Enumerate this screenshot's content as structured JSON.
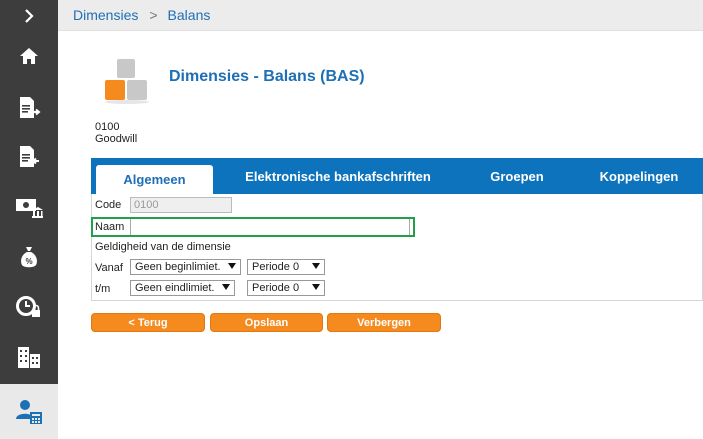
{
  "breadcrumb": [
    "Dimensies",
    "Balans"
  ],
  "header": {
    "title": "Dimensies - Balans (BAS)",
    "account_code": "0100",
    "account_name": "Goodwill"
  },
  "sidebar": {
    "items": [
      {
        "icon": "home-icon"
      },
      {
        "icon": "document-out-icon"
      },
      {
        "icon": "document-in-icon"
      },
      {
        "icon": "bank-icon"
      },
      {
        "icon": "money-bag-icon"
      },
      {
        "icon": "clock-lock-icon"
      },
      {
        "icon": "buildings-icon"
      },
      {
        "icon": "user-calculator-icon",
        "active": true
      }
    ]
  },
  "tabs": [
    {
      "label": "Algemeen",
      "active": true
    },
    {
      "label": "Elektronische bankafschriften"
    },
    {
      "label": "Groepen"
    },
    {
      "label": "Koppelingen"
    }
  ],
  "form": {
    "code_label": "Code",
    "code_value": "0100",
    "naam_label": "Naam",
    "naam_value": "",
    "validity_label": "Geldigheid van de dimensie",
    "from_label": "Vanaf",
    "from_limit": "Geen beginlimiet.",
    "from_period": "Periode 0",
    "to_label": "t/m",
    "to_limit": "Geen eindlimiet.",
    "to_period": "Periode 0"
  },
  "buttons": {
    "back": "< Terug",
    "save": "Opslaan",
    "hide": "Verbergen"
  },
  "colors": {
    "accent_blue": "#0e73bd",
    "orange": "#f58a1f",
    "highlight_green": "#21a04a",
    "sidebar": "#3d3d3d"
  }
}
